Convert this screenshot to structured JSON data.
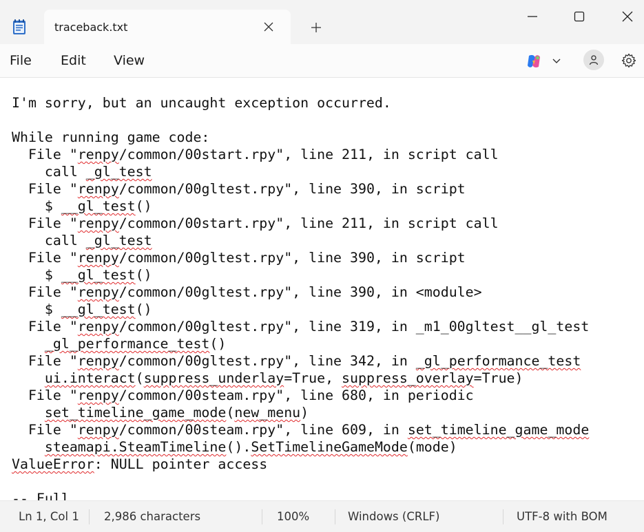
{
  "window": {
    "tab_title": "traceback.txt",
    "icons": {
      "app": "notepad-icon",
      "tab_close": "close-icon",
      "new_tab": "plus-icon",
      "minimize": "minimize-icon",
      "maximize": "maximize-icon",
      "close": "close-icon"
    }
  },
  "menu": {
    "items": [
      "File",
      "Edit",
      "View"
    ],
    "right_icons": [
      "copilot-icon",
      "chevron-down-icon",
      "account-icon",
      "gear-icon"
    ]
  },
  "editor": {
    "spellcheck_color": "#e0282a",
    "lines": [
      [
        {
          "t": "I'm sorry, but an uncaught exception occurred."
        }
      ],
      [],
      [
        {
          "t": "While running game code:"
        }
      ],
      [
        {
          "t": "  File \""
        },
        {
          "t": "renpy",
          "sq": true
        },
        {
          "t": "/common/00start.rpy\", line 211, in script call"
        }
      ],
      [
        {
          "t": "    call "
        },
        {
          "t": "_gl_test",
          "sq": true
        }
      ],
      [
        {
          "t": "  File \""
        },
        {
          "t": "renpy",
          "sq": true
        },
        {
          "t": "/common/00gltest.rpy\", line 390, in script"
        }
      ],
      [
        {
          "t": "    $ "
        },
        {
          "t": "__gl_test",
          "sq": true
        },
        {
          "t": "()"
        }
      ],
      [
        {
          "t": "  File \""
        },
        {
          "t": "renpy",
          "sq": true
        },
        {
          "t": "/common/00start.rpy\", line 211, in script call"
        }
      ],
      [
        {
          "t": "    call "
        },
        {
          "t": "_gl_test",
          "sq": true
        }
      ],
      [
        {
          "t": "  File \""
        },
        {
          "t": "renpy",
          "sq": true
        },
        {
          "t": "/common/00gltest.rpy\", line 390, in script"
        }
      ],
      [
        {
          "t": "    $ "
        },
        {
          "t": "__gl_test",
          "sq": true
        },
        {
          "t": "()"
        }
      ],
      [
        {
          "t": "  File \""
        },
        {
          "t": "renpy",
          "sq": true
        },
        {
          "t": "/common/00gltest.rpy\", line 390, in <module>"
        }
      ],
      [
        {
          "t": "    $ "
        },
        {
          "t": "__gl_test",
          "sq": true
        },
        {
          "t": "()"
        }
      ],
      [
        {
          "t": "  File \""
        },
        {
          "t": "renpy",
          "sq": true
        },
        {
          "t": "/common/00gltest.rpy\", line 319, in _m1_00gltest__gl_test"
        }
      ],
      [
        {
          "t": "    "
        },
        {
          "t": "_gl_performance_test",
          "sq": true
        },
        {
          "t": "()"
        }
      ],
      [
        {
          "t": "  File \""
        },
        {
          "t": "renpy",
          "sq": true
        },
        {
          "t": "/common/00gltest.rpy\", line 342, in "
        },
        {
          "t": "_gl_performance_test",
          "sq": true
        }
      ],
      [
        {
          "t": "    "
        },
        {
          "t": "ui.interact",
          "sq": true
        },
        {
          "t": "("
        },
        {
          "t": "suppress_underlay",
          "sq": true
        },
        {
          "t": "=True, "
        },
        {
          "t": "suppress_overlay",
          "sq": true
        },
        {
          "t": "=True)"
        }
      ],
      [
        {
          "t": "  File \""
        },
        {
          "t": "renpy",
          "sq": true
        },
        {
          "t": "/common/00steam.rpy\", line 680, in periodic"
        }
      ],
      [
        {
          "t": "    "
        },
        {
          "t": "set_timeline_game_mode",
          "sq": true
        },
        {
          "t": "("
        },
        {
          "t": "new_menu",
          "sq": true
        },
        {
          "t": ")"
        }
      ],
      [
        {
          "t": "  File \""
        },
        {
          "t": "renpy",
          "sq": true
        },
        {
          "t": "/common/00steam.rpy\", line 609, in "
        },
        {
          "t": "set_timeline_game_mode",
          "sq": true
        }
      ],
      [
        {
          "t": "    "
        },
        {
          "t": "steamapi.SteamTimeline",
          "sq": true
        },
        {
          "t": "()."
        },
        {
          "t": "SetTimelineGameMode",
          "sq": true
        },
        {
          "t": "(mode)"
        }
      ],
      [
        {
          "t": "ValueError",
          "sq": true
        },
        {
          "t": ": NULL pointer access"
        }
      ],
      [],
      [
        {
          "t": "-- Full"
        }
      ]
    ]
  },
  "status": {
    "position": "Ln 1, Col 1",
    "characters": "2,986 characters",
    "zoom": "100%",
    "line_ending": "Windows (CRLF)",
    "encoding": "UTF-8 with BOM"
  }
}
